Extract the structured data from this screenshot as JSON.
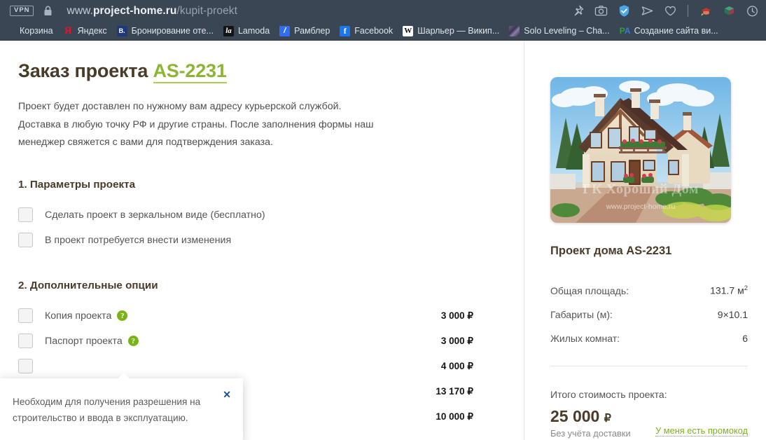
{
  "browser": {
    "vpn_badge": "VPN",
    "lock_icon": "lock-icon",
    "url_pre": "www.",
    "url_host": "project-home.ru",
    "url_path": "/kupit-proekt",
    "toolbar_icons": [
      {
        "name": "pin-icon"
      },
      {
        "name": "camera-icon"
      },
      {
        "name": "shield-check-icon"
      },
      {
        "name": "send-icon"
      },
      {
        "name": "heart-icon"
      },
      {
        "name": "separator"
      },
      {
        "name": "hat-pencil-icon"
      },
      {
        "name": "cube-icon"
      },
      {
        "name": "clock-icon"
      }
    ],
    "bookmarks": [
      {
        "label": "Корзина",
        "icon": "basket-icon"
      },
      {
        "label": "Яндекс",
        "icon": "yandex-icon",
        "icon_text": "Я"
      },
      {
        "label": "Бронирование оте...",
        "icon": "booking-icon",
        "icon_text": "B."
      },
      {
        "label": "Lamoda",
        "icon": "lamoda-icon",
        "icon_text": "la"
      },
      {
        "label": "Рамблер",
        "icon": "rambler-icon",
        "icon_text": "/"
      },
      {
        "label": "Facebook",
        "icon": "facebook-icon",
        "icon_text": "f"
      },
      {
        "label": "Шарльер — Викип...",
        "icon": "wikipedia-icon",
        "icon_text": "W"
      },
      {
        "label": "Solo Leveling – Cha...",
        "icon": "solo-leveling-icon",
        "icon_text": ""
      },
      {
        "label": "Создание сайта ви...",
        "icon": "pa-icon",
        "icon_text": "PA"
      }
    ]
  },
  "page": {
    "title_main": "Заказ проекта",
    "title_code": "AS-2231",
    "intro": "Проект будет доставлен по нужному вам адресу курьерской службой. Доставка в любую точку РФ и другие страны. После заполнения формы наш менеджер свяжется с вами для подтверждения заказа.",
    "section1": {
      "title": "1. Параметры проекта",
      "options": [
        {
          "label": "Сделать проект в зеркальном виде (бесплатно)",
          "checked": false,
          "help": false,
          "price": ""
        },
        {
          "label": "В проект потребуется внести изменения",
          "checked": false,
          "help": false,
          "price": ""
        }
      ]
    },
    "section2": {
      "title": "2. Дополнительные опции",
      "options": [
        {
          "label": "Копия проекта",
          "checked": false,
          "help": true,
          "price": "3 000 ₽"
        },
        {
          "label": "Паспорт проекта",
          "checked": false,
          "help": true,
          "price": "3 000 ₽"
        },
        {
          "label": "",
          "checked": false,
          "help": false,
          "price": "4 000 ₽"
        },
        {
          "label": "",
          "checked": false,
          "help": false,
          "price": "13 170 ₽"
        },
        {
          "label": "",
          "checked": false,
          "help": true,
          "price": "10 000 ₽"
        }
      ]
    },
    "tooltip": {
      "text": "Необходим для получения разрешения на строительство и ввода в эксплуатацию.",
      "close_label": "✕"
    }
  },
  "sidebar": {
    "image_name": "house-render-image",
    "watermark": "ГК Хороший Дом",
    "watermark_url": "www.project-home.ru",
    "project_title": "Проект дома AS-2231",
    "specs": [
      {
        "label": "Общая площадь:",
        "value": "131.7 м",
        "sup": "2"
      },
      {
        "label": "Габариты (м):",
        "value": "9×10.1",
        "sup": ""
      },
      {
        "label": "Жилых комнат:",
        "value": "6",
        "sup": ""
      }
    ],
    "total_label": "Итого стоимость проекта:",
    "total_value": "25 000",
    "total_currency": "₽",
    "total_note": "Без учёта доставки",
    "promo_link": "У меня есть промокод"
  },
  "colors": {
    "chrome_bg": "#3b4654",
    "brand_brown": "#4a3b28",
    "accent_green": "#8db534",
    "help_green": "#7ab317",
    "link_blue": "#16539e"
  }
}
